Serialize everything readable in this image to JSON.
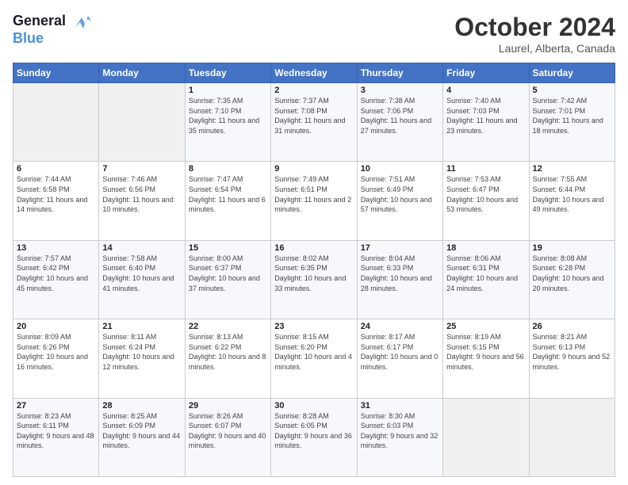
{
  "header": {
    "logo_line1": "General",
    "logo_line2": "Blue",
    "month": "October 2024",
    "location": "Laurel, Alberta, Canada"
  },
  "days_of_week": [
    "Sunday",
    "Monday",
    "Tuesday",
    "Wednesday",
    "Thursday",
    "Friday",
    "Saturday"
  ],
  "weeks": [
    [
      {
        "day": "",
        "info": ""
      },
      {
        "day": "",
        "info": ""
      },
      {
        "day": "1",
        "sunrise": "Sunrise: 7:35 AM",
        "sunset": "Sunset: 7:10 PM",
        "daylight": "Daylight: 11 hours and 35 minutes."
      },
      {
        "day": "2",
        "sunrise": "Sunrise: 7:37 AM",
        "sunset": "Sunset: 7:08 PM",
        "daylight": "Daylight: 11 hours and 31 minutes."
      },
      {
        "day": "3",
        "sunrise": "Sunrise: 7:38 AM",
        "sunset": "Sunset: 7:06 PM",
        "daylight": "Daylight: 11 hours and 27 minutes."
      },
      {
        "day": "4",
        "sunrise": "Sunrise: 7:40 AM",
        "sunset": "Sunset: 7:03 PM",
        "daylight": "Daylight: 11 hours and 23 minutes."
      },
      {
        "day": "5",
        "sunrise": "Sunrise: 7:42 AM",
        "sunset": "Sunset: 7:01 PM",
        "daylight": "Daylight: 11 hours and 18 minutes."
      }
    ],
    [
      {
        "day": "6",
        "sunrise": "Sunrise: 7:44 AM",
        "sunset": "Sunset: 6:58 PM",
        "daylight": "Daylight: 11 hours and 14 minutes."
      },
      {
        "day": "7",
        "sunrise": "Sunrise: 7:46 AM",
        "sunset": "Sunset: 6:56 PM",
        "daylight": "Daylight: 11 hours and 10 minutes."
      },
      {
        "day": "8",
        "sunrise": "Sunrise: 7:47 AM",
        "sunset": "Sunset: 6:54 PM",
        "daylight": "Daylight: 11 hours and 6 minutes."
      },
      {
        "day": "9",
        "sunrise": "Sunrise: 7:49 AM",
        "sunset": "Sunset: 6:51 PM",
        "daylight": "Daylight: 11 hours and 2 minutes."
      },
      {
        "day": "10",
        "sunrise": "Sunrise: 7:51 AM",
        "sunset": "Sunset: 6:49 PM",
        "daylight": "Daylight: 10 hours and 57 minutes."
      },
      {
        "day": "11",
        "sunrise": "Sunrise: 7:53 AM",
        "sunset": "Sunset: 6:47 PM",
        "daylight": "Daylight: 10 hours and 53 minutes."
      },
      {
        "day": "12",
        "sunrise": "Sunrise: 7:55 AM",
        "sunset": "Sunset: 6:44 PM",
        "daylight": "Daylight: 10 hours and 49 minutes."
      }
    ],
    [
      {
        "day": "13",
        "sunrise": "Sunrise: 7:57 AM",
        "sunset": "Sunset: 6:42 PM",
        "daylight": "Daylight: 10 hours and 45 minutes."
      },
      {
        "day": "14",
        "sunrise": "Sunrise: 7:58 AM",
        "sunset": "Sunset: 6:40 PM",
        "daylight": "Daylight: 10 hours and 41 minutes."
      },
      {
        "day": "15",
        "sunrise": "Sunrise: 8:00 AM",
        "sunset": "Sunset: 6:37 PM",
        "daylight": "Daylight: 10 hours and 37 minutes."
      },
      {
        "day": "16",
        "sunrise": "Sunrise: 8:02 AM",
        "sunset": "Sunset: 6:35 PM",
        "daylight": "Daylight: 10 hours and 33 minutes."
      },
      {
        "day": "17",
        "sunrise": "Sunrise: 8:04 AM",
        "sunset": "Sunset: 6:33 PM",
        "daylight": "Daylight: 10 hours and 28 minutes."
      },
      {
        "day": "18",
        "sunrise": "Sunrise: 8:06 AM",
        "sunset": "Sunset: 6:31 PM",
        "daylight": "Daylight: 10 hours and 24 minutes."
      },
      {
        "day": "19",
        "sunrise": "Sunrise: 8:08 AM",
        "sunset": "Sunset: 6:28 PM",
        "daylight": "Daylight: 10 hours and 20 minutes."
      }
    ],
    [
      {
        "day": "20",
        "sunrise": "Sunrise: 8:09 AM",
        "sunset": "Sunset: 6:26 PM",
        "daylight": "Daylight: 10 hours and 16 minutes."
      },
      {
        "day": "21",
        "sunrise": "Sunrise: 8:11 AM",
        "sunset": "Sunset: 6:24 PM",
        "daylight": "Daylight: 10 hours and 12 minutes."
      },
      {
        "day": "22",
        "sunrise": "Sunrise: 8:13 AM",
        "sunset": "Sunset: 6:22 PM",
        "daylight": "Daylight: 10 hours and 8 minutes."
      },
      {
        "day": "23",
        "sunrise": "Sunrise: 8:15 AM",
        "sunset": "Sunset: 6:20 PM",
        "daylight": "Daylight: 10 hours and 4 minutes."
      },
      {
        "day": "24",
        "sunrise": "Sunrise: 8:17 AM",
        "sunset": "Sunset: 6:17 PM",
        "daylight": "Daylight: 10 hours and 0 minutes."
      },
      {
        "day": "25",
        "sunrise": "Sunrise: 8:19 AM",
        "sunset": "Sunset: 6:15 PM",
        "daylight": "Daylight: 9 hours and 56 minutes."
      },
      {
        "day": "26",
        "sunrise": "Sunrise: 8:21 AM",
        "sunset": "Sunset: 6:13 PM",
        "daylight": "Daylight: 9 hours and 52 minutes."
      }
    ],
    [
      {
        "day": "27",
        "sunrise": "Sunrise: 8:23 AM",
        "sunset": "Sunset: 6:11 PM",
        "daylight": "Daylight: 9 hours and 48 minutes."
      },
      {
        "day": "28",
        "sunrise": "Sunrise: 8:25 AM",
        "sunset": "Sunset: 6:09 PM",
        "daylight": "Daylight: 9 hours and 44 minutes."
      },
      {
        "day": "29",
        "sunrise": "Sunrise: 8:26 AM",
        "sunset": "Sunset: 6:07 PM",
        "daylight": "Daylight: 9 hours and 40 minutes."
      },
      {
        "day": "30",
        "sunrise": "Sunrise: 8:28 AM",
        "sunset": "Sunset: 6:05 PM",
        "daylight": "Daylight: 9 hours and 36 minutes."
      },
      {
        "day": "31",
        "sunrise": "Sunrise: 8:30 AM",
        "sunset": "Sunset: 6:03 PM",
        "daylight": "Daylight: 9 hours and 32 minutes."
      },
      {
        "day": "",
        "info": ""
      },
      {
        "day": "",
        "info": ""
      }
    ]
  ]
}
